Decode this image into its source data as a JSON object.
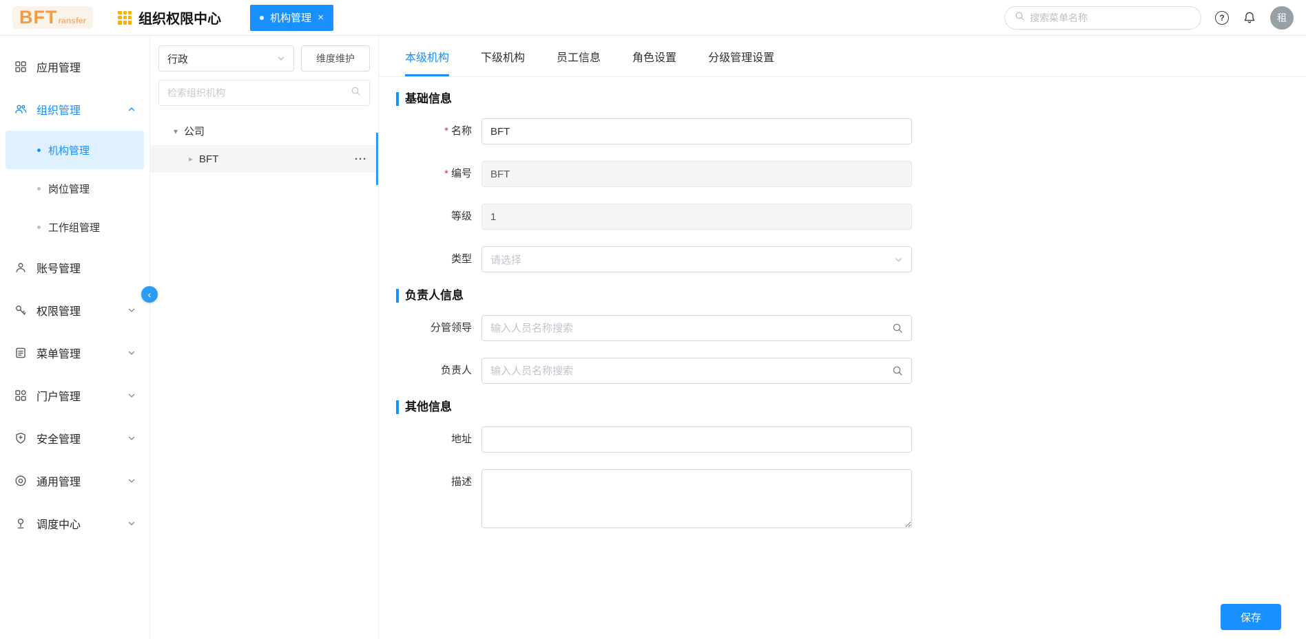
{
  "colors": {
    "primary": "#1890ff",
    "logo_orange": "#f59a3e"
  },
  "icons": {
    "caret_down": "▾",
    "caret_right": "▸",
    "more": "···",
    "close": "×",
    "collapse": "‹",
    "help": "?"
  },
  "topbar": {
    "logo_main": "BFT",
    "logo_sub": "ransfer",
    "app_title": "组织权限中心",
    "tab_label": "机构管理",
    "search_placeholder": "搜索菜单名称",
    "avatar_text": "租"
  },
  "sidebar": {
    "items": [
      {
        "label": "应用管理"
      },
      {
        "label": "组织管理"
      },
      {
        "label": "账号管理"
      },
      {
        "label": "权限管理"
      },
      {
        "label": "菜单管理"
      },
      {
        "label": "门户管理"
      },
      {
        "label": "安全管理"
      },
      {
        "label": "通用管理"
      },
      {
        "label": "调度中心"
      }
    ],
    "org_children": [
      {
        "label": "机构管理"
      },
      {
        "label": "岗位管理"
      },
      {
        "label": "工作组管理"
      }
    ]
  },
  "tree_panel": {
    "dimension_value": "行政",
    "maintain_button": "维度维护",
    "search_placeholder": "检索组织机构",
    "root_label": "公司",
    "child_label": "BFT"
  },
  "main": {
    "tabs": [
      {
        "label": "本级机构"
      },
      {
        "label": "下级机构"
      },
      {
        "label": "员工信息"
      },
      {
        "label": "角色设置"
      },
      {
        "label": "分级管理设置"
      }
    ],
    "required_mark": "*",
    "sections": {
      "basic": {
        "title": "基础信息"
      },
      "leader": {
        "title": "负责人信息"
      },
      "other": {
        "title": "其他信息"
      }
    },
    "fields": {
      "name": {
        "label": "名称",
        "value": "BFT"
      },
      "code": {
        "label": "编号",
        "value": "BFT"
      },
      "level": {
        "label": "等级",
        "value": "1"
      },
      "type": {
        "label": "类型",
        "placeholder": "请选择"
      },
      "leader": {
        "label": "分管领导",
        "placeholder": "输入人员名称搜索"
      },
      "manager": {
        "label": "负责人",
        "placeholder": "输入人员名称搜索"
      },
      "address": {
        "label": "地址"
      },
      "description": {
        "label": "描述"
      }
    },
    "save_label": "保存"
  }
}
